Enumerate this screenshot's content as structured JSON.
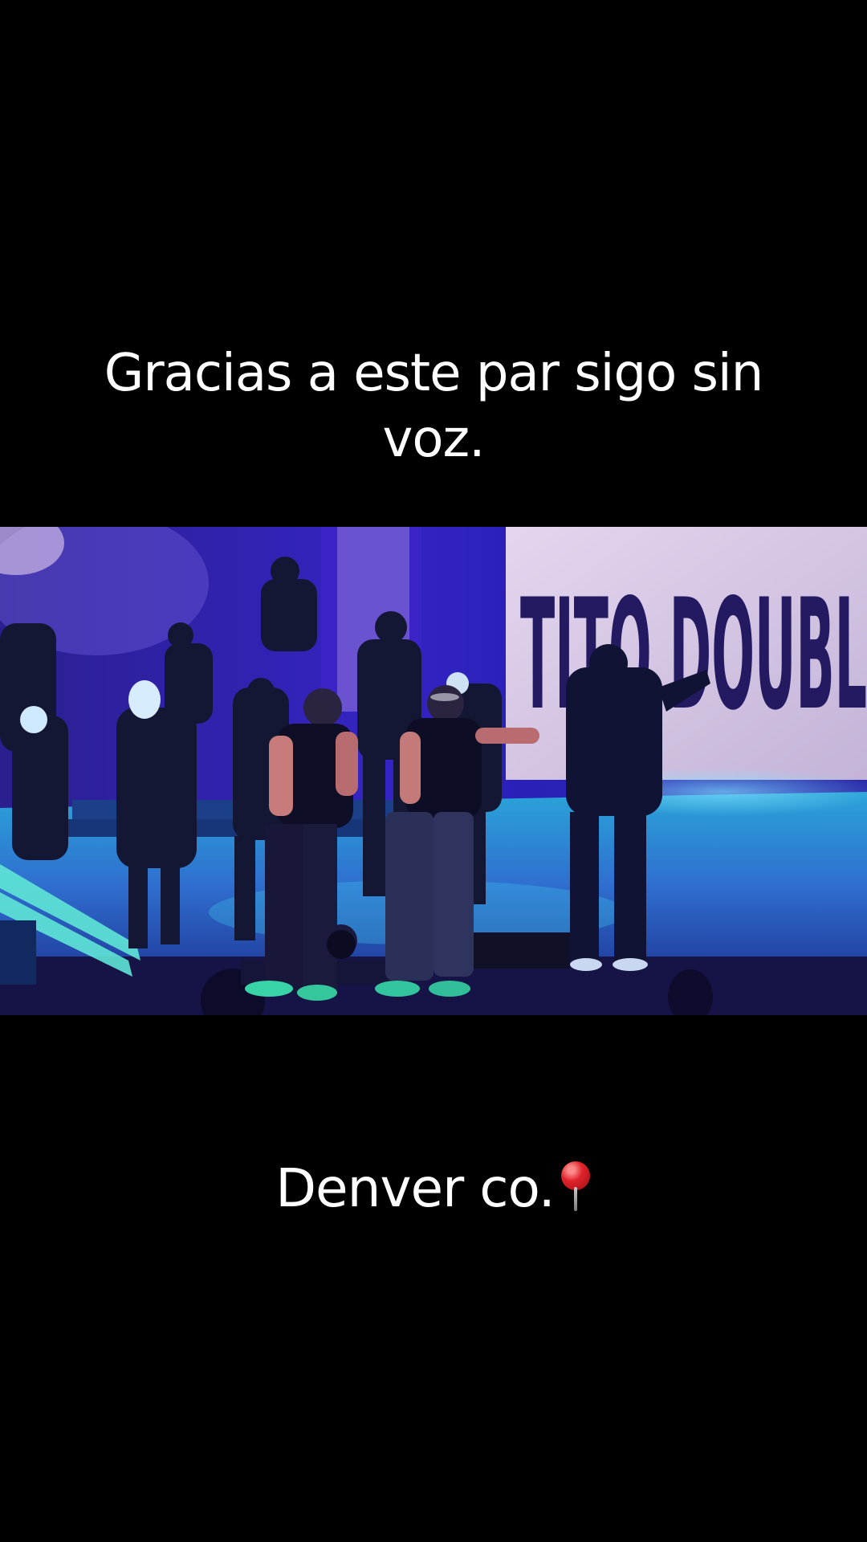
{
  "caption_top": {
    "line1": "Gracias a este par sigo sin",
    "line2": "voz."
  },
  "caption_bottom": {
    "text": "Denver co.",
    "emoji": "round-pushpin-icon"
  },
  "video": {
    "screen_text": "TITO DOUBL",
    "colors": {
      "background": "#000000",
      "stage_blue": "#3b2fd0",
      "screen": "#d9c9e4",
      "floor": "#1e90c8"
    }
  }
}
